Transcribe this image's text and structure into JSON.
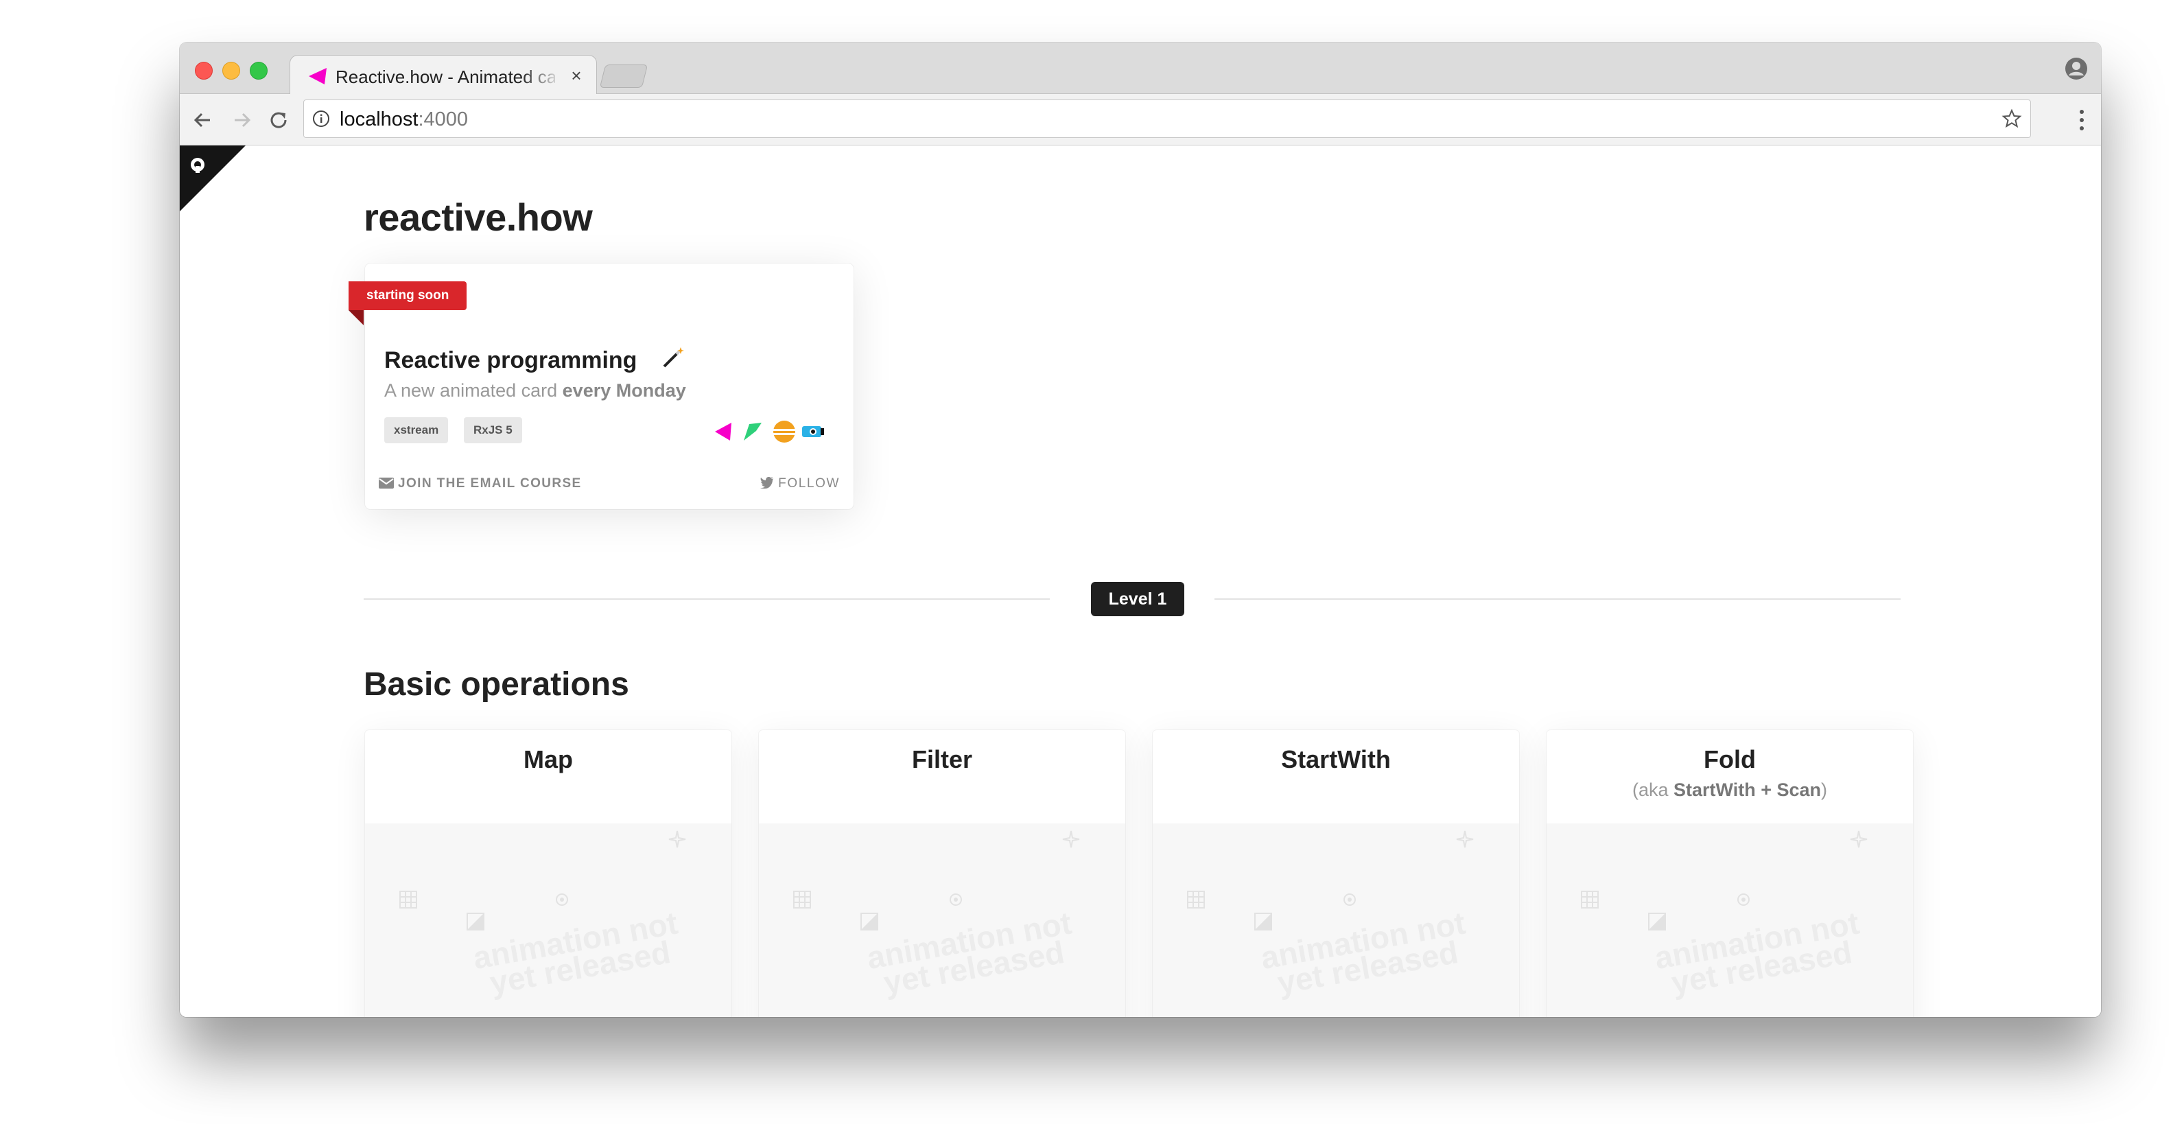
{
  "browser": {
    "tab": {
      "title": "Reactive.how - Animated cards"
    },
    "address_bar": {
      "host": "localhost",
      "port": ":4000"
    }
  },
  "site": {
    "title": "reactive.how"
  },
  "featured_card": {
    "ribbon": "starting soon",
    "title": "Reactive programming",
    "subtitle_prefix": "A new animated card ",
    "subtitle_bold": "every Monday",
    "tags": [
      "xstream",
      "RxJS 5"
    ],
    "footer_left": "JOIN THE EMAIL COURSE",
    "footer_right": "FOLLOW"
  },
  "level": {
    "label": "Level 1"
  },
  "section": {
    "title": "Basic operations",
    "cards": [
      {
        "title": "Map"
      },
      {
        "title": "Filter"
      },
      {
        "title": "StartWith"
      },
      {
        "title": "Fold",
        "sub_prefix": "(aka ",
        "sub_bold": "StartWith + Scan",
        "sub_suffix": ")"
      }
    ],
    "placeholder_text": "animation not yet released"
  },
  "colors": {
    "ribbon": "#d9262b",
    "badge": "#1f1f1f",
    "xstream": "#f700c9",
    "most": "#2ed07a",
    "bacon": "#f2a11f",
    "kefir": "#2ab1e6"
  }
}
